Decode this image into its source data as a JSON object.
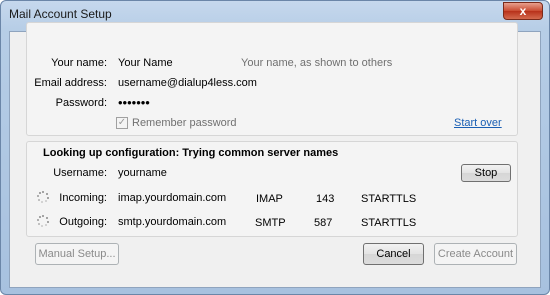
{
  "window": {
    "title": "Mail Account Setup",
    "close_label": "x"
  },
  "account": {
    "name_label": "Your name:",
    "name_value": "Your Name",
    "name_hint": "Your name, as shown to others",
    "email_label": "Email address:",
    "email_value": "username@dialup4less.com",
    "password_label": "Password:",
    "password_value": "•••••••",
    "remember_label": "Remember password",
    "remember_checked": true,
    "start_over": "Start over"
  },
  "config": {
    "heading": "Looking up configuration: Trying common server names",
    "username_label": "Username:",
    "username_value": "yourname",
    "stop_label": "Stop",
    "incoming": {
      "label": "Incoming:",
      "server": "imap.yourdomain.com",
      "protocol": "IMAP",
      "port": "143",
      "security": "STARTTLS"
    },
    "outgoing": {
      "label": "Outgoing:",
      "server": "smtp.yourdomain.com",
      "protocol": "SMTP",
      "port": "587",
      "security": "STARTTLS"
    }
  },
  "buttons": {
    "manual_setup": "Manual Setup...",
    "cancel": "Cancel",
    "create_account": "Create Account"
  },
  "icons": {
    "spinner": "loading-spinner-icon",
    "close": "close-icon",
    "check": "checkmark-icon"
  }
}
